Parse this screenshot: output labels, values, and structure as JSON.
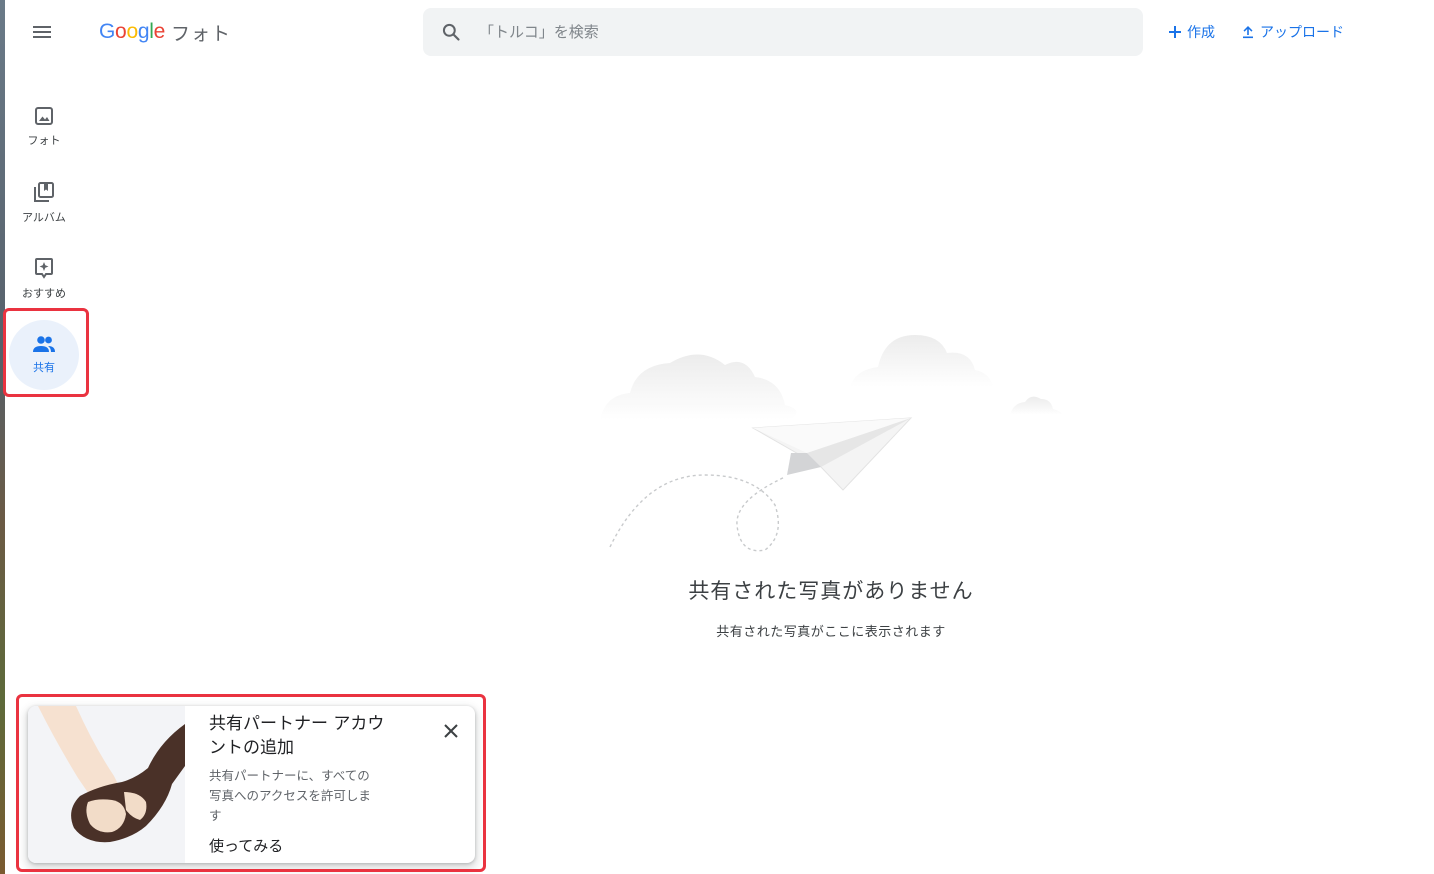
{
  "header": {
    "menu_icon": "hamburger-menu-icon",
    "logo_google": "Google",
    "logo_product": "フォト",
    "search_placeholder": "「トルコ」を検索",
    "create_label": "作成",
    "upload_label": "アップロード",
    "colors": {
      "accent": "#1a73e8",
      "search_bg": "#f1f3f4"
    }
  },
  "sidebar": {
    "items": [
      {
        "label": "フォト",
        "icon": "photo-icon",
        "active": false
      },
      {
        "label": "アルバム",
        "icon": "album-icon",
        "active": false
      },
      {
        "label": "おすすめ",
        "icon": "suggestions-icon",
        "active": false
      },
      {
        "label": "共有",
        "icon": "people-icon",
        "active": true
      }
    ]
  },
  "main": {
    "empty_title": "共有された写真がありません",
    "empty_subtitle": "共有された写真がここに表示されます",
    "illustration": "paper-plane-clouds-illustration"
  },
  "partner_card": {
    "title": "共有パートナー アカウントの追加",
    "description": "共有パートナーに、すべての写真へのアクセスを許可します",
    "action_label": "使ってみる",
    "close_icon": "close-icon",
    "image": "holding-hands-illustration"
  },
  "highlight_color": "#ea3340"
}
